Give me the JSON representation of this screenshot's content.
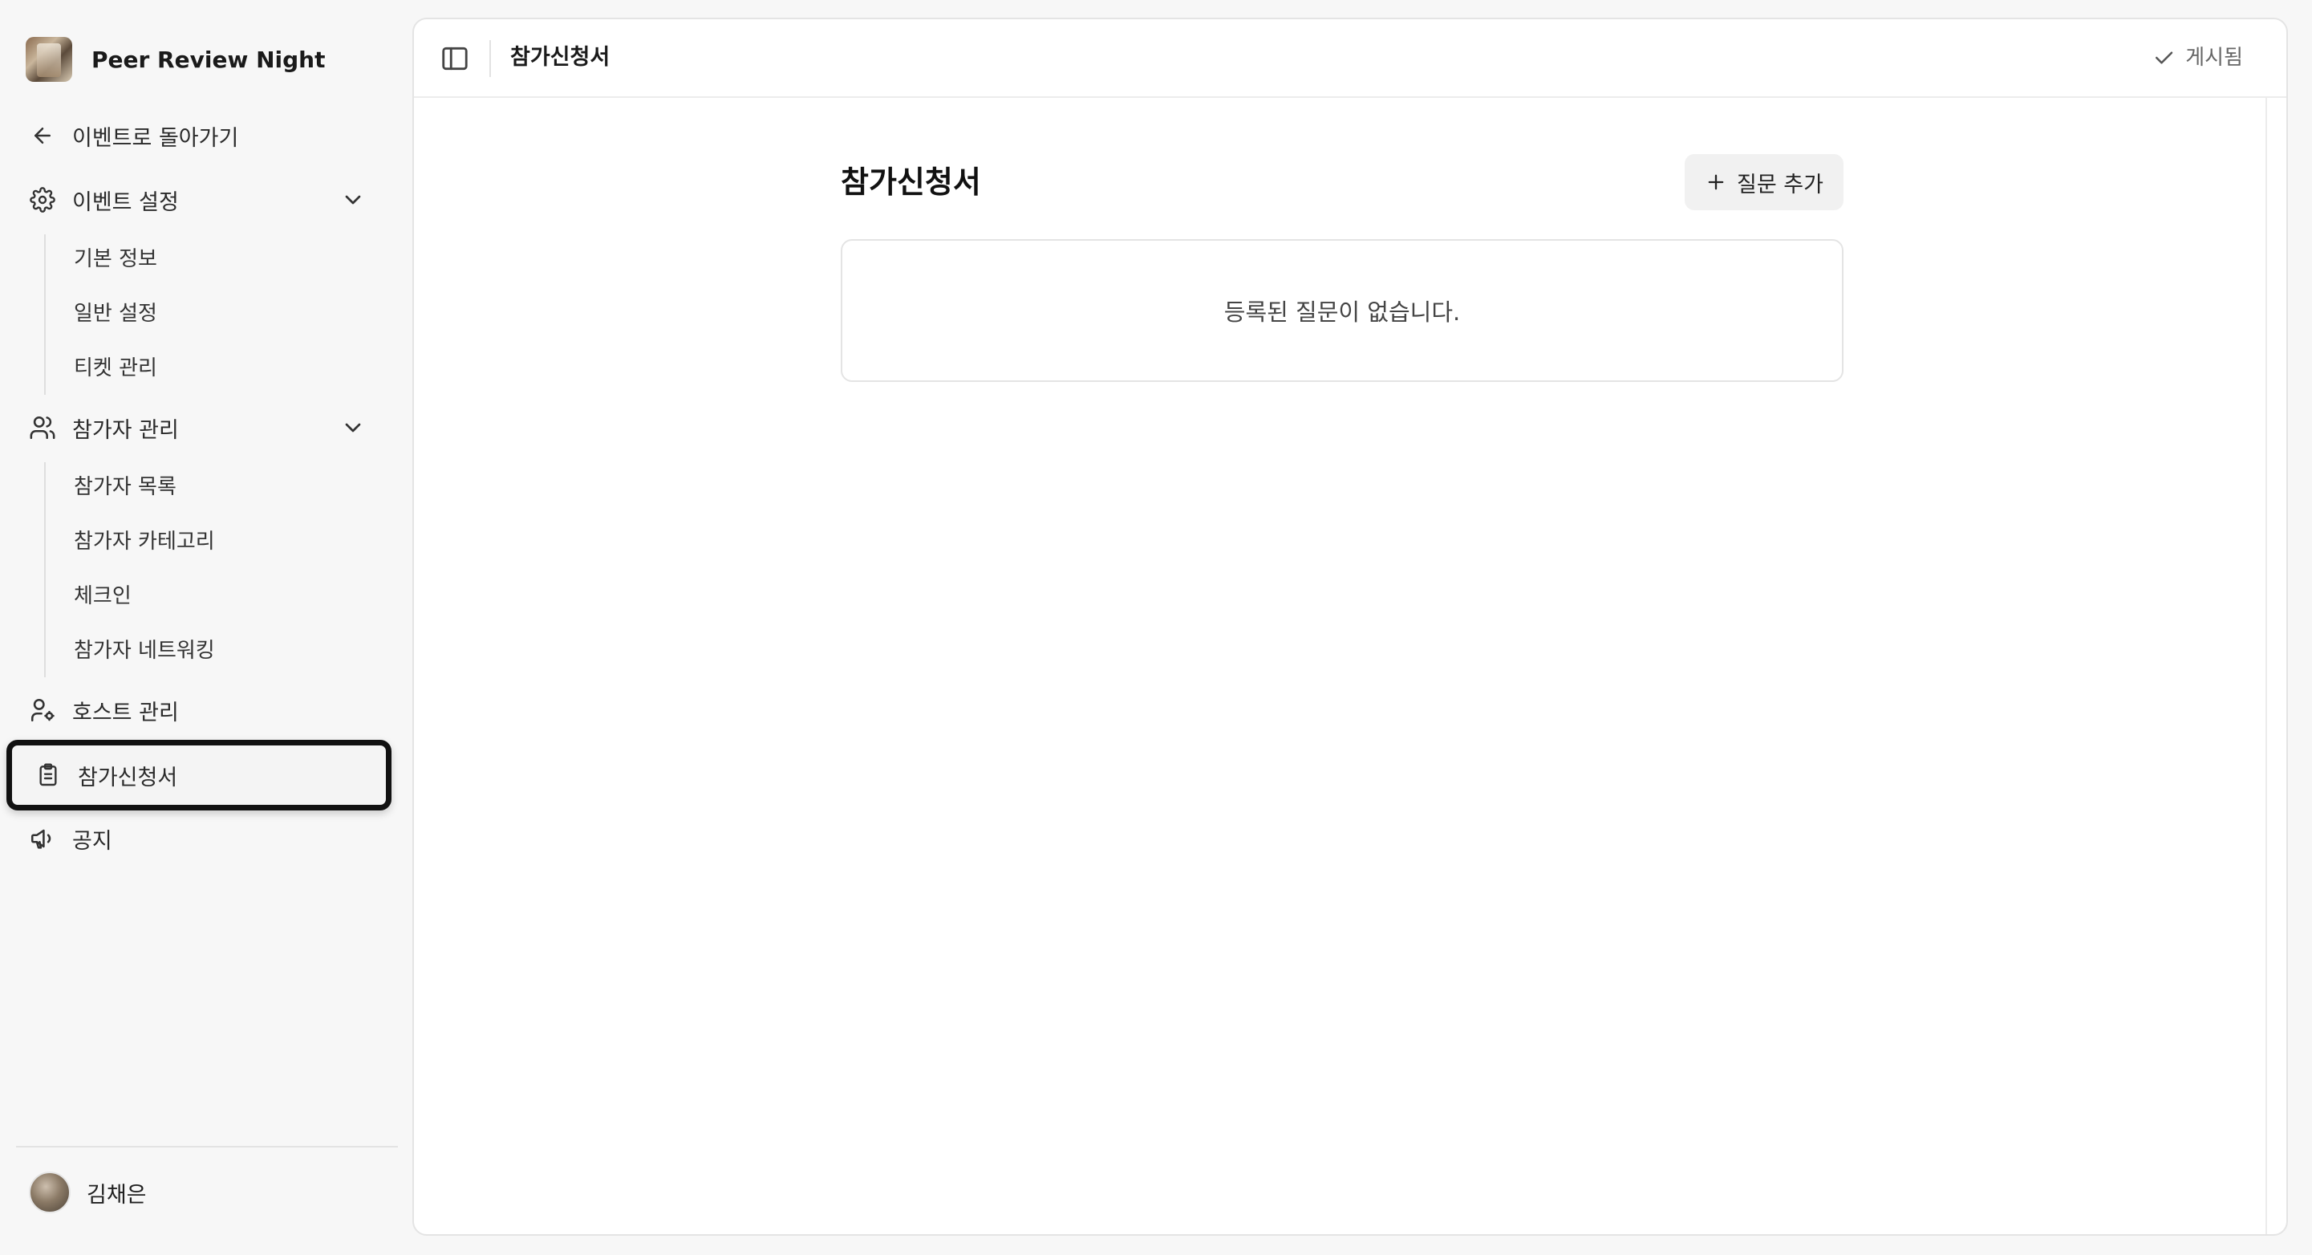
{
  "event": {
    "title": "Peer Review Night"
  },
  "sidebar": {
    "back_label": "이벤트로 돌아가기",
    "event_settings": {
      "label": "이벤트 설정",
      "items": [
        "기본 정보",
        "일반 설정",
        "티켓 관리"
      ]
    },
    "attendees": {
      "label": "참가자 관리",
      "items": [
        "참가자 목록",
        "참가자 카테고리",
        "체크인",
        "참가자 네트워킹"
      ]
    },
    "hosts_label": "호스트 관리",
    "application_label": "참가신청서",
    "notice_label": "공지"
  },
  "user": {
    "name": "김채은"
  },
  "topbar": {
    "title": "참가신청서",
    "status": "게시됨"
  },
  "main": {
    "heading": "참가신청서",
    "add_button": "질문 추가",
    "empty_message": "등록된 질문이 없습니다."
  },
  "icons": {
    "back": "arrow-left-icon",
    "settings": "gear-icon",
    "users": "users-icon",
    "host": "user-gear-icon",
    "application": "clipboard-list-icon",
    "notice": "megaphone-icon",
    "sidebar_toggle": "panel-left-icon",
    "status": "check-icon",
    "add": "plus-icon"
  }
}
